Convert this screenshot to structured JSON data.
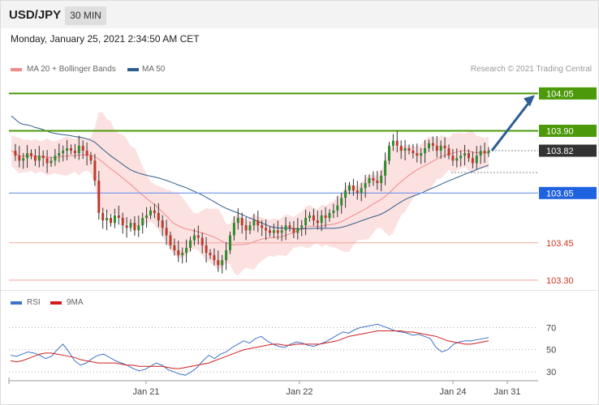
{
  "header": {
    "symbol": "USD/JPY",
    "timeframe": "30 MIN"
  },
  "datetime": "Monday, January 25, 2021 2:34:50 AM CET",
  "legend": {
    "ma20_label": "MA 20 + Bollinger Bands",
    "ma50_label": "MA 50",
    "ma20_color": "#f28a8a",
    "ma50_color": "#2e5d8c"
  },
  "credit": "Research © 2021 Trading Central",
  "chart_data": [
    {
      "type": "candlestick",
      "title": "USD/JPY",
      "ylim": [
        103.28,
        104.1
      ],
      "x_ticks": [
        "Jan 21",
        "Jan 22",
        "Jan 24",
        "Jan 31"
      ],
      "levels": [
        {
          "label": "104.05",
          "value": 104.05,
          "kind": "target",
          "color": "#4c9a0a"
        },
        {
          "label": "103.90",
          "value": 103.9,
          "kind": "resistance",
          "color": "#4c9a0a"
        },
        {
          "label": "103.82",
          "value": 103.82,
          "kind": "last-price",
          "color": "#333333"
        },
        {
          "label": "103.65",
          "value": 103.65,
          "kind": "pivot",
          "color": "#1f62e0"
        },
        {
          "label": "103.45",
          "value": 103.45,
          "kind": "support",
          "color": "#d0331f"
        },
        {
          "label": "103.30",
          "value": 103.3,
          "kind": "support",
          "color": "#d0331f"
        }
      ],
      "series": [
        {
          "name": "MA 20 + Bollinger Bands",
          "color": "#f28a8a"
        },
        {
          "name": "MA 50",
          "color": "#2e5d8c"
        }
      ],
      "price_path": [
        103.82,
        103.8,
        103.78,
        103.79,
        103.81,
        103.8,
        103.78,
        103.8,
        103.79,
        103.77,
        103.78,
        103.8,
        103.81,
        103.82,
        103.83,
        103.82,
        103.81,
        103.84,
        103.82,
        103.8,
        103.78,
        103.7,
        103.57,
        103.54,
        103.55,
        103.53,
        103.56,
        103.55,
        103.52,
        103.51,
        103.53,
        103.5,
        103.52,
        103.55,
        103.56,
        103.58,
        103.57,
        103.54,
        103.51,
        103.48,
        103.44,
        103.42,
        103.4,
        103.41,
        103.43,
        103.46,
        103.48,
        103.47,
        103.44,
        103.41,
        103.4,
        103.38,
        103.36,
        103.38,
        103.42,
        103.48,
        103.53,
        103.55,
        103.52,
        103.5,
        103.52,
        103.54,
        103.52,
        103.51,
        103.5,
        103.49,
        103.5,
        103.49,
        103.5,
        103.52,
        103.51,
        103.49,
        103.51,
        103.52,
        103.55,
        103.56,
        103.54,
        103.53,
        103.56,
        103.55,
        103.57,
        103.58,
        103.6,
        103.63,
        103.66,
        103.68,
        103.66,
        103.65,
        103.67,
        103.69,
        103.71,
        103.7,
        103.69,
        103.72,
        103.78,
        103.84,
        103.86,
        103.84,
        103.82,
        103.83,
        103.82,
        103.81,
        103.8,
        103.81,
        103.83,
        103.85,
        103.84,
        103.82,
        103.84,
        103.83,
        103.8,
        103.78,
        103.79,
        103.8,
        103.81,
        103.79,
        103.77,
        103.8,
        103.82,
        103.81,
        103.82
      ]
    },
    {
      "type": "line",
      "title": "RSI",
      "ylim": [
        22,
        82
      ],
      "y_ticks": [
        70,
        50,
        30
      ],
      "series": [
        {
          "name": "RSI",
          "color": "#3f72c8",
          "values": [
            45,
            44,
            46,
            48,
            47,
            45,
            42,
            44,
            50,
            55,
            48,
            40,
            36,
            38,
            42,
            45,
            46,
            43,
            40,
            38,
            36,
            33,
            31,
            32,
            35,
            38,
            36,
            32,
            30,
            28,
            27,
            30,
            34,
            40,
            45,
            42,
            46,
            48,
            52,
            55,
            58,
            56,
            60,
            62,
            58,
            55,
            53,
            52,
            55,
            57,
            56,
            54,
            53,
            55,
            57,
            60,
            63,
            66,
            65,
            68,
            70,
            71,
            72,
            73,
            71,
            69,
            67,
            66,
            65,
            63,
            64,
            62,
            60,
            52,
            48,
            50,
            55,
            57,
            58,
            58,
            59,
            60,
            61
          ]
        },
        {
          "name": "9MA",
          "color": "#d11f1f",
          "values": [
            40,
            39,
            40,
            42,
            44,
            46,
            47,
            47,
            46,
            45,
            44,
            43,
            41,
            40,
            39,
            38,
            38,
            38,
            38,
            37,
            36,
            36,
            35,
            35,
            35,
            35,
            35,
            34,
            33,
            33,
            34,
            35,
            36,
            37,
            38,
            40,
            42,
            44,
            46,
            48,
            50,
            51,
            52,
            53,
            54,
            55,
            55,
            54,
            54,
            55,
            55,
            55,
            55,
            55,
            56,
            57,
            58,
            60,
            62,
            63,
            64,
            65,
            66,
            67,
            67,
            67,
            67,
            67,
            66,
            66,
            65,
            64,
            63,
            62,
            60,
            58,
            57,
            56,
            55,
            55,
            56,
            57,
            58
          ]
        }
      ]
    }
  ],
  "rsi_legend": {
    "rsi_label": "RSI",
    "ma_label": "9MA"
  }
}
